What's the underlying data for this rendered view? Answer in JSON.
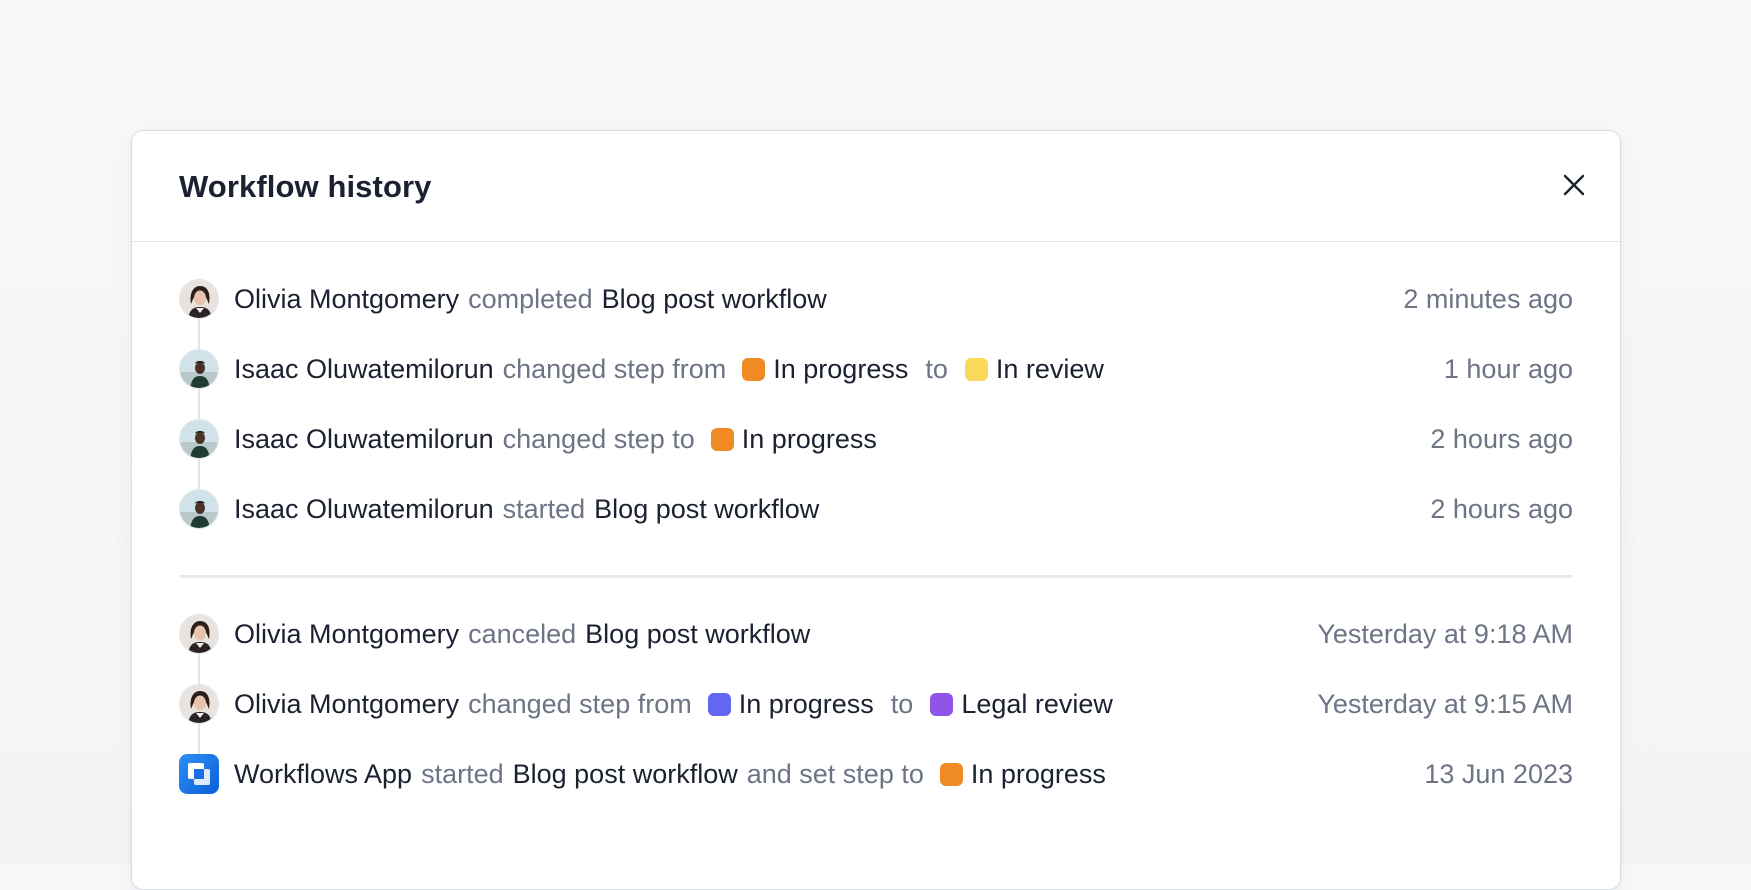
{
  "modal": {
    "title": "Workflow history",
    "close_icon": "close-icon"
  },
  "groups": [
    {
      "entries": [
        {
          "actor": "Olivia Montgomery",
          "avatar": "olivia",
          "verb": "completed",
          "object": "Blog post workflow",
          "time": "2 minutes ago"
        },
        {
          "actor": "Isaac Oluwatemilorun",
          "avatar": "isaac",
          "verb": "changed step from",
          "from": {
            "label": "In progress",
            "color": "#f08a24"
          },
          "conj": "to",
          "to": {
            "label": "In review",
            "color": "#fad85a"
          },
          "time": "1 hour ago"
        },
        {
          "actor": "Isaac Oluwatemilorun",
          "avatar": "isaac",
          "verb": "changed step to",
          "to": {
            "label": "In progress",
            "color": "#f08a24"
          },
          "time": "2 hours ago"
        },
        {
          "actor": "Isaac Oluwatemilorun",
          "avatar": "isaac",
          "verb": "started",
          "object": "Blog post workflow",
          "time": "2 hours ago"
        }
      ]
    },
    {
      "entries": [
        {
          "actor": "Olivia Montgomery",
          "avatar": "olivia",
          "verb": "canceled",
          "object": "Blog post workflow",
          "time": "Yesterday at 9:18 AM"
        },
        {
          "actor": "Olivia Montgomery",
          "avatar": "olivia",
          "verb": "changed step from",
          "from": {
            "label": "In progress",
            "color": "#6366f1"
          },
          "conj": "to",
          "to": {
            "label": "Legal review",
            "color": "#9055e8"
          },
          "time": "Yesterday at 9:15 AM"
        },
        {
          "actor": "Workflows App",
          "avatar": "app",
          "verb": "started",
          "object": "Blog post workflow",
          "verb2": "and set step to",
          "to": {
            "label": "In progress",
            "color": "#f08a24"
          },
          "time": "13 Jun 2023"
        }
      ]
    }
  ]
}
